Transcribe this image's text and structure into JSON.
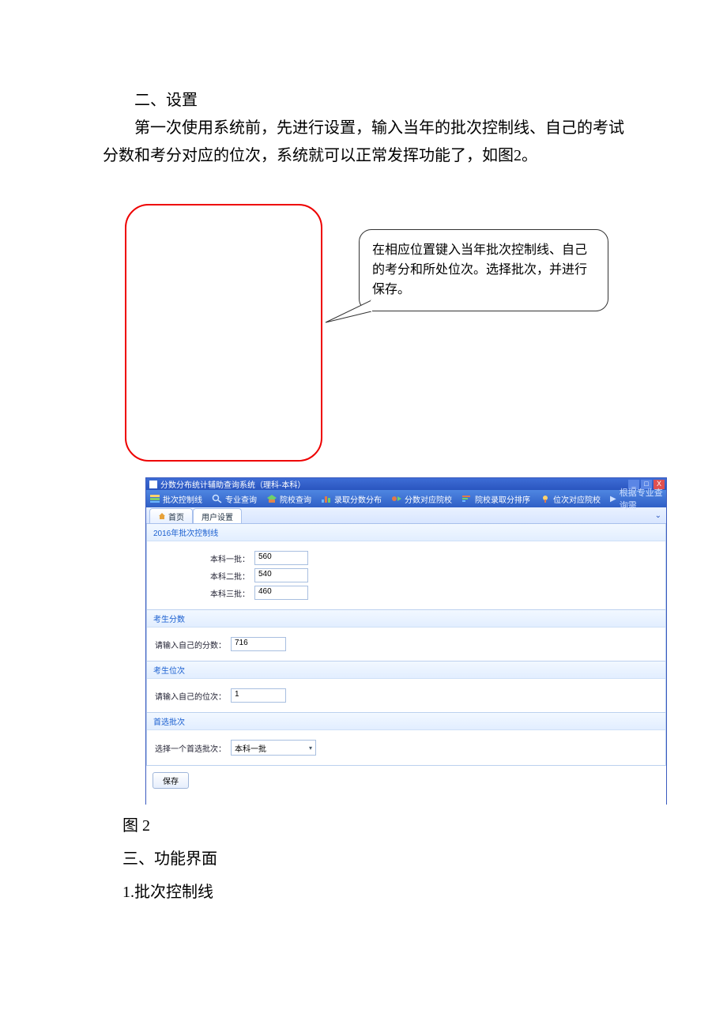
{
  "doc": {
    "heading2": "二、设置",
    "para1": "第一次使用系统前，先进行设置，输入当年的批次控制线、自己的考试分数和考分对应的位次，系统就可以正常发挥功能了，如图2。",
    "figcaption": "图 2",
    "heading3": "三、功能界面",
    "item1": "1.批次控制线"
  },
  "callout": {
    "text": "在相应位置键入当年批次控制线、自己的考分和所处位次。选择批次，并进行保存。"
  },
  "app": {
    "title": "分数分布统计辅助查询系统（理科-本科）",
    "win": {
      "min": "_",
      "max": "□",
      "close": "X"
    },
    "toolbar": {
      "items": [
        {
          "icon": "stack",
          "label": "批次控制线"
        },
        {
          "icon": "search",
          "label": "专业查询"
        },
        {
          "icon": "school",
          "label": "院校查询"
        },
        {
          "icon": "dist",
          "label": "录取分数分布"
        },
        {
          "icon": "match",
          "label": "分数对应院校"
        },
        {
          "icon": "rank",
          "label": "院校录取分排序"
        },
        {
          "icon": "pos",
          "label": "位次对应院校"
        }
      ],
      "right": "根据专业查询需"
    },
    "tabs": {
      "home": "首页",
      "settings": "用户设置"
    },
    "sections": {
      "cutoff": {
        "title": "2016年批次控制线",
        "rows": [
          {
            "label": "本科一批：",
            "value": "560"
          },
          {
            "label": "本科二批：",
            "value": "540"
          },
          {
            "label": "本科三批：",
            "value": "460"
          }
        ]
      },
      "score": {
        "title": "考生分数",
        "label": "请输入自己的分数：",
        "value": "716"
      },
      "rank": {
        "title": "考生位次",
        "label": "请输入自己的位次：",
        "value": "1"
      },
      "pref": {
        "title": "首选批次",
        "label": "选择一个首选批次：",
        "value": "本科一批"
      }
    },
    "save": "保存"
  }
}
